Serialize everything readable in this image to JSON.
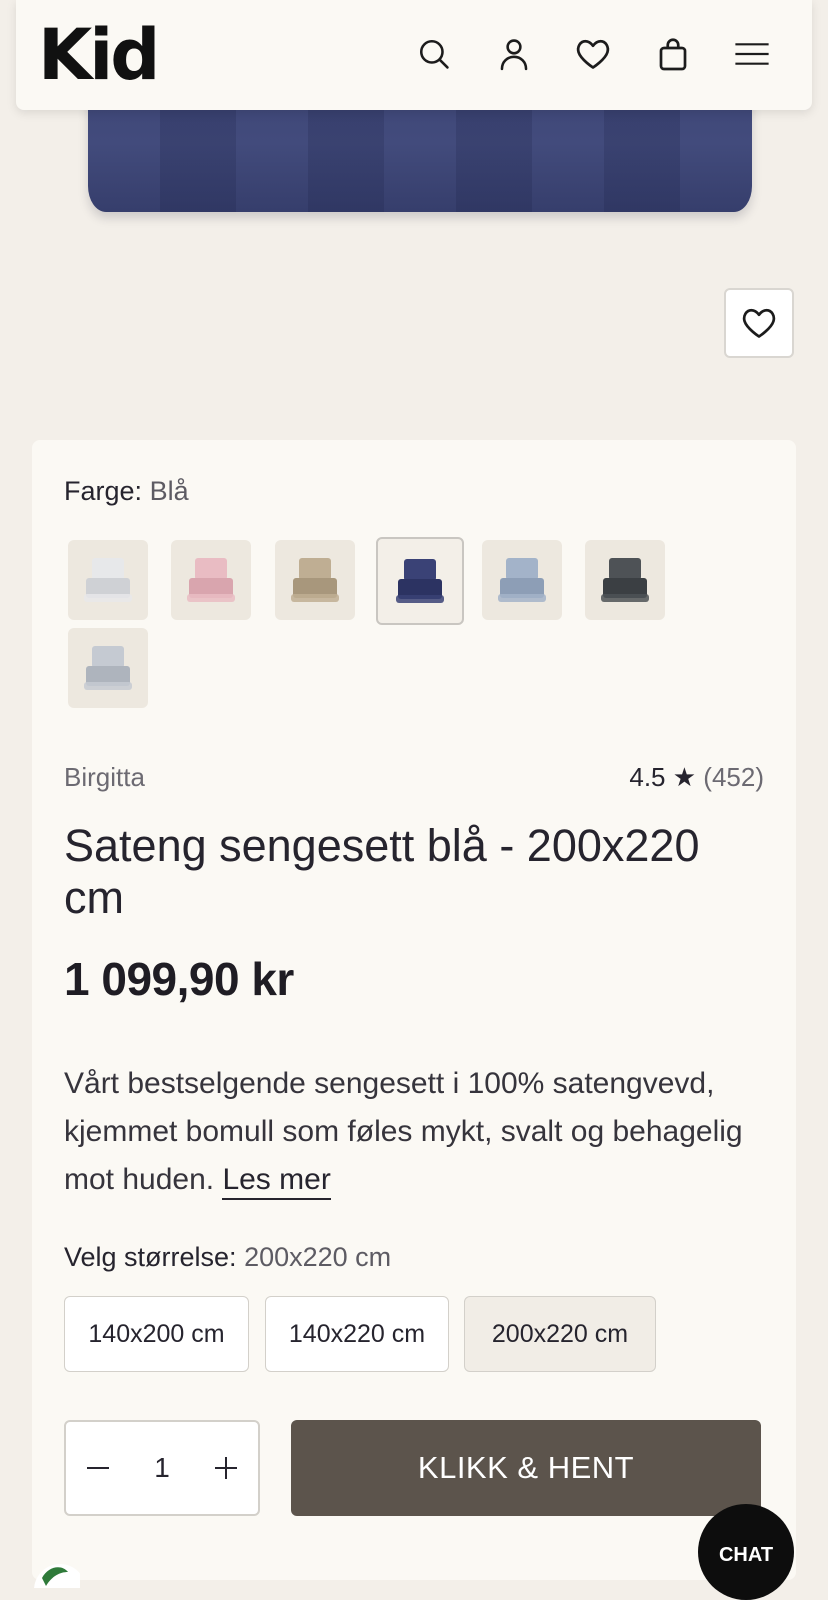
{
  "header": {
    "logo": "Kid",
    "icons": [
      "search-icon",
      "account-icon",
      "wishlist-icon",
      "cart-icon",
      "menu-icon"
    ]
  },
  "hero": {
    "favorite_icon": "heart-icon"
  },
  "color": {
    "label": "Farge:",
    "value": "Blå",
    "swatches": [
      {
        "name": "hvit",
        "main": "#e7e8ea",
        "accent": "#cfd1d5",
        "selected": false
      },
      {
        "name": "rosa",
        "main": "#e9bcc3",
        "accent": "#d9a5ae",
        "selected": false
      },
      {
        "name": "beige",
        "main": "#bfae93",
        "accent": "#a8977c",
        "selected": false
      },
      {
        "name": "blå",
        "main": "#3a4276",
        "accent": "#2c3362",
        "selected": true
      },
      {
        "name": "lyseblå",
        "main": "#a3b3c9",
        "accent": "#8d9eb6",
        "selected": false
      },
      {
        "name": "grå",
        "main": "#4e5256",
        "accent": "#3b3f43",
        "selected": false
      },
      {
        "name": "lys grå",
        "main": "#c5cad2",
        "accent": "#aeb4bd",
        "selected": false
      }
    ]
  },
  "product": {
    "brand": "Birgitta",
    "rating": "4.5",
    "star": "★",
    "review_count": "(452)",
    "title": "Sateng sengesett blå - 200x220 cm",
    "price": "1 099,90 kr",
    "description": "Vårt bestselgende sengesett i 100% satengvevd, kjemmet bomull som føles mykt, svalt og behagelig mot huden. ",
    "read_more": "Les mer"
  },
  "size": {
    "label": "Velg størrelse:",
    "value": "200x220 cm",
    "options": [
      "140x200 cm",
      "140x220 cm",
      "200x220 cm"
    ],
    "selected_index": 2
  },
  "purchase": {
    "quantity": "1",
    "cta_label": "KLIKK & HENT"
  },
  "chat": {
    "label": "CHAT"
  },
  "colors": {
    "background": "#f3efe9",
    "card": "#fbf9f4",
    "cta": "#5c544c",
    "text": "#26242e"
  }
}
